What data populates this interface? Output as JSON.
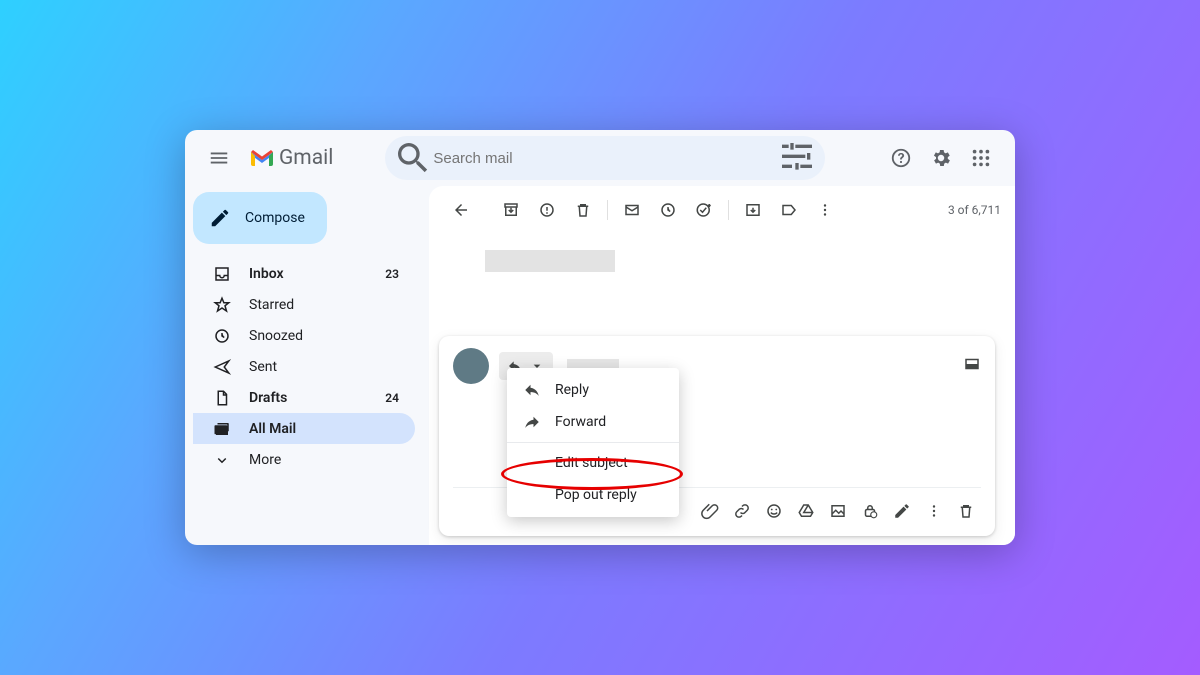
{
  "app_name": "Gmail",
  "search": {
    "placeholder": "Search mail"
  },
  "compose_label": "Compose",
  "pagination": "3 of 6,711",
  "sidebar": {
    "items": [
      {
        "id": "inbox",
        "label": "Inbox",
        "count": "23",
        "bold": true
      },
      {
        "id": "starred",
        "label": "Starred",
        "count": "",
        "bold": false
      },
      {
        "id": "snoozed",
        "label": "Snoozed",
        "count": "",
        "bold": false
      },
      {
        "id": "sent",
        "label": "Sent",
        "count": "",
        "bold": false
      },
      {
        "id": "drafts",
        "label": "Drafts",
        "count": "24",
        "bold": true
      },
      {
        "id": "allmail",
        "label": "All Mail",
        "count": "",
        "bold": true,
        "active": true
      },
      {
        "id": "more",
        "label": "More",
        "count": "",
        "bold": false
      }
    ]
  },
  "reply_menu": {
    "reply": "Reply",
    "forward": "Forward",
    "edit_subject": "Edit subject",
    "pop_out": "Pop out reply"
  }
}
